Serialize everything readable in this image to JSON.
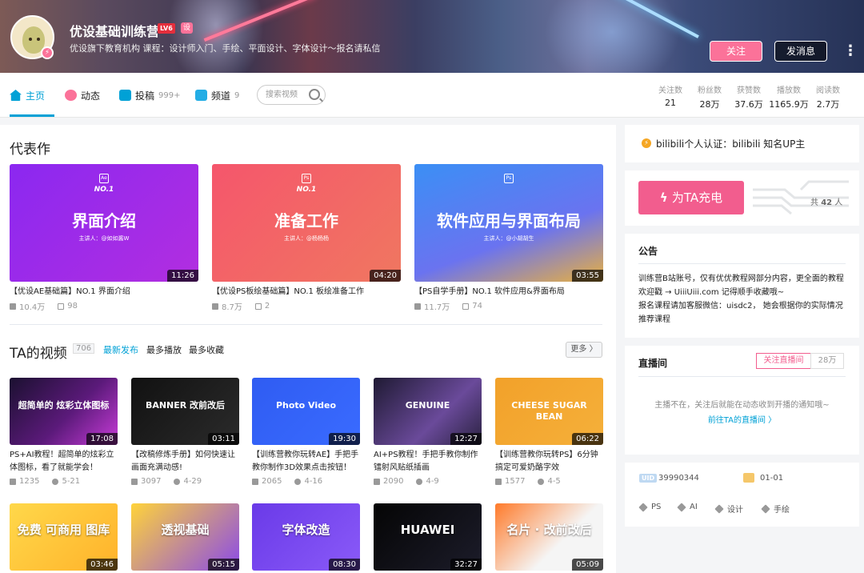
{
  "header": {
    "username": "优设基础训练营",
    "level": "LV6",
    "vip": "设",
    "sign": "优设旗下教育机构 课程：设计师入门、手绘、平面设计、字体设计～报名请私信",
    "follow_label": "关注",
    "message_label": "发消息",
    "more_label": "⋮"
  },
  "nav": {
    "items": [
      {
        "label": "主页"
      },
      {
        "label": "动态"
      },
      {
        "label": "投稿",
        "count": "999+"
      },
      {
        "label": "频道",
        "count": "9"
      }
    ],
    "search_placeholder": "搜索视频",
    "stats": [
      {
        "label": "关注数",
        "value": "21"
      },
      {
        "label": "粉丝数",
        "value": "28万"
      },
      {
        "label": "获赞数",
        "value": "37.6万"
      },
      {
        "label": "播放数",
        "value": "1165.9万"
      },
      {
        "label": "阅读数",
        "value": "2.7万"
      }
    ]
  },
  "featured": {
    "title": "代表作",
    "cards": [
      {
        "big": "界面介绍",
        "no": "NO.1",
        "lecturer": "主讲人：@如如酱W",
        "app": "Ae",
        "duration": "11:26",
        "title": "【优设AE基础篇】NO.1 界面介绍",
        "plays": "10.4万",
        "danmaku": "98",
        "bg": "linear-gradient(135deg,#8b28f0,#b22ee0)"
      },
      {
        "big": "准备工作",
        "no": "NO.1",
        "lecturer": "主讲人：@杨杨杨",
        "app": "Ps",
        "duration": "04:20",
        "title": "【优设PS板绘基础篇】NO.1 板绘准备工作",
        "plays": "8.7万",
        "danmaku": "2",
        "bg": "linear-gradient(135deg,#f5566c,#f07760)"
      },
      {
        "big": "软件应用与界面布局",
        "no": "",
        "lecturer": "主讲人：@小胡胡生",
        "app": "Ps",
        "duration": "03:55",
        "title": "【PS自学手册】NO.1 软件应用&界面布局",
        "plays": "11.7万",
        "danmaku": "74",
        "bg": "linear-gradient(160deg,#3b8ff5,#6a73f0 60%,#e8b040)"
      }
    ]
  },
  "videos": {
    "title": "TA的视频",
    "count": "706",
    "tabs": [
      "最新发布",
      "最多播放",
      "最多收藏"
    ],
    "more_label": "更多 〉",
    "row1": [
      {
        "thumb_text": "超简单的 炫彩立体图标",
        "duration": "17:08",
        "title": "PS+AI教程！超简单的炫彩立体图标，看了就能学会！",
        "plays": "1235",
        "date": "5-21",
        "bg": "linear-gradient(135deg,#1b1030,#5b1a7a 55%,#c83cd8)"
      },
      {
        "thumb_text": "BANNER 改前改后",
        "duration": "03:11",
        "title": "【改稿修炼手册】如何快速让画面充满动感!",
        "plays": "3097",
        "date": "4-29",
        "bg": "linear-gradient(135deg,#111,#2b2b2b)"
      },
      {
        "thumb_text": "Photo  Video",
        "duration": "19:30",
        "title": "【训练营教你玩转AE】手把手教你制作3D效果点击按钮！",
        "plays": "2065",
        "date": "4-16",
        "bg": "linear-gradient(135deg,#2f5cf2,#3a6bff)"
      },
      {
        "thumb_text": "GENUINE",
        "duration": "12:27",
        "title": "AI+PS教程！手把手教你制作镭射风贴纸插画",
        "plays": "2090",
        "date": "4-9",
        "bg": "linear-gradient(135deg,#1f1a33,#6a4a9a 60%,#2a2240)"
      },
      {
        "thumb_text": "CHEESE SUGAR BEAN",
        "duration": "06:22",
        "title": "【训练营教你玩转PS】6分钟搞定可爱奶酪字效",
        "plays": "1577",
        "date": "4-5",
        "bg": "linear-gradient(135deg,#f2a12a,#f5b03a)"
      }
    ],
    "row2": [
      {
        "thumb_text": "免费 可商用 图库",
        "duration": "03:46",
        "bg": "linear-gradient(135deg,#ffd84a,#ffb22a)"
      },
      {
        "thumb_text": "透视基础",
        "duration": "05:15",
        "bg": "linear-gradient(135deg,#ffd33a,#8a4ae8)"
      },
      {
        "thumb_text": "字体改造",
        "duration": "08:30",
        "bg": "linear-gradient(135deg,#6a3ae8,#8a5af8)"
      },
      {
        "thumb_text": "HUAWEI",
        "duration": "32:27",
        "bg": "linear-gradient(135deg,#050505,#1c1c2a)"
      },
      {
        "thumb_text": "名片 · 改前改后",
        "duration": "05:09",
        "bg": "linear-gradient(135deg,#ff7a2a,#f5f5f5 60%)"
      }
    ]
  },
  "sidebar": {
    "verify": "bilibili个人认证：bilibili 知名UP主",
    "charge_label": "为TA充电",
    "charge_count_prefix": "共",
    "charge_count": "42",
    "charge_count_suffix": "人",
    "notice_title": "公告",
    "notice_lines": [
      "训练营B站账号，仅有优优教程网部分内容，更全面的教程",
      "欢迎戳 → UiiiUiii.com 记得顺手收藏哦~",
      "报名课程请加客服微信：uisdc2， 她会根据你的实际情况",
      "推荐课程"
    ],
    "live_title": "直播间",
    "live_follow_label": "关注直播间",
    "live_follow_count": "28万",
    "live_empty": "主播不在，关注后就能在动态收到开播的通知哦~",
    "live_link": "前往TA的直播间  〉",
    "uid_label": "UID",
    "uid": "39990344",
    "birthday": "01-01",
    "tags": [
      "PS",
      "AI",
      "设计",
      "手绘"
    ]
  }
}
